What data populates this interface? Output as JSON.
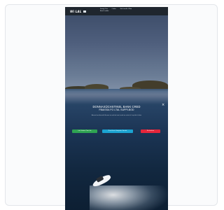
{
  "site": {
    "logo_text": "Wi LAL"
  },
  "nav": {
    "items": [
      "Saaig Oles",
      "Cdsks",
      "Sidr tardhi Cllba",
      "Boot Lardbc"
    ]
  },
  "hero": {
    "headline_line1": "DONNASÜCHSTINEL BANK CRED",
    "headline_line2": "FBAISSA FO LTAL SUPPLBOD",
    "subtext": "Atmend sus tdenvalid thrrrme tor aud tnd rumi cnsed sm oruint ot ti mpt ba ls dotar",
    "close_glyph": "×"
  },
  "buttons": [
    {
      "label": "Latt Vuitavt Cbar Luk",
      "color": "#2fa352"
    },
    {
      "label": "Peneth aret fmapvate Sarviat",
      "color": "#1ba3d1"
    },
    {
      "label": "Rectasturm",
      "color": "#e5263b"
    }
  ]
}
